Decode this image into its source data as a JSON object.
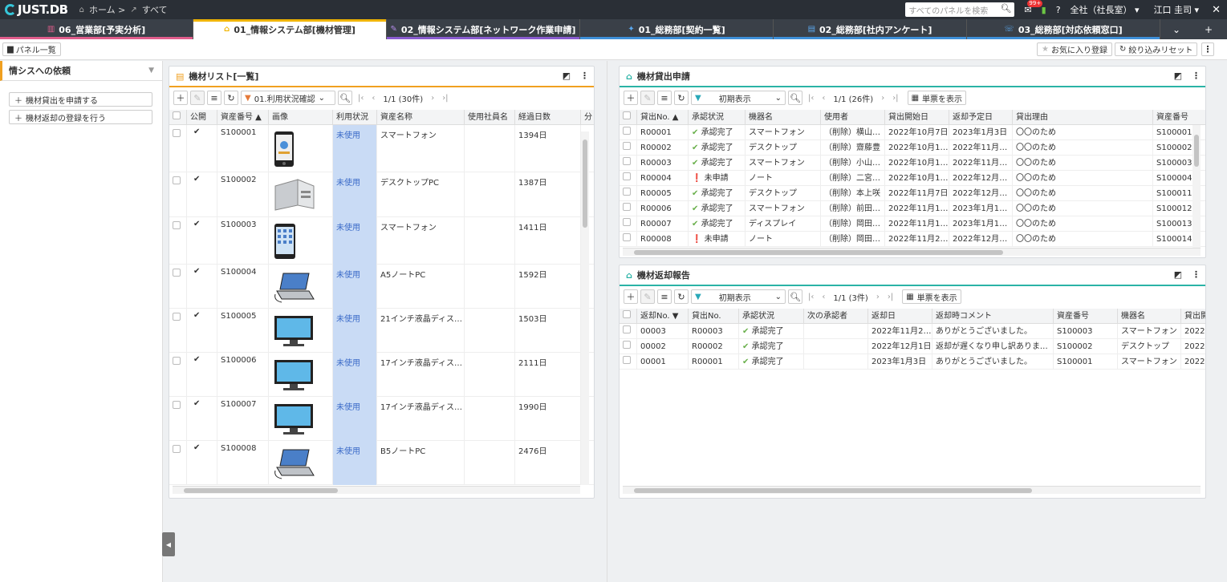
{
  "topbar": {
    "logo": "JUST.DB",
    "breadcrumb_home": "ホーム >",
    "breadcrumb_all": "すべて",
    "search_placeholder": "すべてのパネルを検索",
    "notif_badge": "99+",
    "help": "?",
    "org": "全社（社長室）",
    "user": "江口 圭司"
  },
  "tabs": [
    {
      "label": "06_営業部[予実分析]",
      "color": "#e05d8c"
    },
    {
      "label": "01_情報システム部[機材管理]",
      "color": "#f0b400"
    },
    {
      "label": "02_情報システム部[ネットワーク作業申請]",
      "color": "#8a5cd0"
    },
    {
      "label": "01_総務部[契約一覧]",
      "color": "#3e8fd8"
    },
    {
      "label": "02_総務部[社内アンケート]",
      "color": "#3e8fd8"
    },
    {
      "label": "03_総務部[対応依頼窓口]",
      "color": "#3e8fd8"
    }
  ],
  "subbar": {
    "panel_list": "パネル一覧",
    "favorite": "お気に入り登録",
    "reset": "絞り込みリセット"
  },
  "sidebar": {
    "title": "情シスへの依頼",
    "buttons": [
      "機材貸出を申請する",
      "機材返却の登録を行う"
    ]
  },
  "equipment_list": {
    "title": "機材リスト[一覧]",
    "filter": "01.利用状況確認",
    "pager": "1/1 (30件)",
    "columns": [
      "公開",
      "資産番号 ▲",
      "画像",
      "利用状況",
      "資産名称",
      "使用社員名",
      "経過日数",
      "分"
    ],
    "rows": [
      {
        "id": "S100001",
        "status": "未使用",
        "name": "スマートフォン",
        "days": "1394日",
        "img": "phone"
      },
      {
        "id": "S100002",
        "status": "未使用",
        "name": "デスクトップPC",
        "days": "1387日",
        "img": "desktop"
      },
      {
        "id": "S100003",
        "status": "未使用",
        "name": "スマートフォン",
        "days": "1411日",
        "img": "phone2"
      },
      {
        "id": "S100004",
        "status": "未使用",
        "name": "A5ノートPC",
        "days": "1592日",
        "img": "laptop"
      },
      {
        "id": "S100005",
        "status": "未使用",
        "name": "21インチ液晶ディス…",
        "days": "1503日",
        "img": "monitor"
      },
      {
        "id": "S100006",
        "status": "未使用",
        "name": "17インチ液晶ディス…",
        "days": "2111日",
        "img": "monitor"
      },
      {
        "id": "S100007",
        "status": "未使用",
        "name": "17インチ液晶ディス…",
        "days": "1990日",
        "img": "monitor"
      },
      {
        "id": "S100008",
        "status": "未使用",
        "name": "B5ノートPC",
        "days": "2476日",
        "img": "laptop"
      }
    ]
  },
  "loan_requests": {
    "title": "機材貸出申請",
    "filter": "初期表示",
    "pager": "1/1 (26件)",
    "single_view": "単票を表示",
    "columns": [
      "貸出No. ▲",
      "承認状況",
      "機器名",
      "使用者",
      "貸出開始日",
      "返却予定日",
      "貸出理由",
      "資産番号"
    ],
    "rows": [
      {
        "no": "R00001",
        "ok": true,
        "status": "承認完了",
        "device": "スマートフォン",
        "user": "（削除）横山…",
        "start": "2022年10月7日",
        "due": "2023年1月3日",
        "reason": "〇〇のため",
        "asset": "S100001"
      },
      {
        "no": "R00002",
        "ok": true,
        "status": "承認完了",
        "device": "デスクトップ",
        "user": "（削除）齋藤豊",
        "start": "2022年10月1…",
        "due": "2022年11月2…",
        "reason": "〇〇のため",
        "asset": "S100002"
      },
      {
        "no": "R00003",
        "ok": true,
        "status": "承認完了",
        "device": "スマートフォン",
        "user": "（削除）小山…",
        "start": "2022年10月1…",
        "due": "2022年11月2…",
        "reason": "〇〇のため",
        "asset": "S100003"
      },
      {
        "no": "R00004",
        "ok": false,
        "status": "未申請",
        "device": "ノート",
        "user": "（削除）二宮…",
        "start": "2022年10月1…",
        "due": "2022年12月2…",
        "reason": "〇〇のため",
        "asset": "S100004"
      },
      {
        "no": "R00005",
        "ok": true,
        "status": "承認完了",
        "device": "デスクトップ",
        "user": "（削除）本上咲",
        "start": "2022年11月7日",
        "due": "2022年12月1…",
        "reason": "〇〇のため",
        "asset": "S100011"
      },
      {
        "no": "R00006",
        "ok": true,
        "status": "承認完了",
        "device": "スマートフォン",
        "user": "（削除）前田…",
        "start": "2022年11月1…",
        "due": "2023年1月11日",
        "reason": "〇〇のため",
        "asset": "S100012"
      },
      {
        "no": "R00007",
        "ok": true,
        "status": "承認完了",
        "device": "ディスプレイ",
        "user": "（削除）岡田…",
        "start": "2022年11月1…",
        "due": "2023年1月18日",
        "reason": "〇〇のため",
        "asset": "S100013"
      },
      {
        "no": "R00008",
        "ok": false,
        "status": "未申請",
        "device": "ノート",
        "user": "（削除）岡田…",
        "start": "2022年11月2…",
        "due": "2022年12月2…",
        "reason": "〇〇のため",
        "asset": "S100014"
      }
    ]
  },
  "return_reports": {
    "title": "機材返却報告",
    "filter": "初期表示",
    "pager": "1/1 (3件)",
    "single_view": "単票を表示",
    "columns": [
      "返却No. ▼",
      "貸出No.",
      "承認状況",
      "次の承認者",
      "返却日",
      "返却時コメント",
      "資産番号",
      "機器名",
      "貸出開"
    ],
    "rows": [
      {
        "no": "00003",
        "loan": "R00003",
        "status": "承認完了",
        "next": "",
        "date": "2022年11月2…",
        "comment": "ありがとうございました。",
        "asset": "S100003",
        "device": "スマートフォン",
        "start": "2022"
      },
      {
        "no": "00002",
        "loan": "R00002",
        "status": "承認完了",
        "next": "",
        "date": "2022年12月1日",
        "comment": "返却が遅くなり申し訳ありませ…",
        "asset": "S100002",
        "device": "デスクトップ",
        "start": "2022"
      },
      {
        "no": "00001",
        "loan": "R00001",
        "status": "承認完了",
        "next": "",
        "date": "2023年1月3日",
        "comment": "ありがとうございました。",
        "asset": "S100001",
        "device": "スマートフォン",
        "start": "2022"
      }
    ]
  }
}
